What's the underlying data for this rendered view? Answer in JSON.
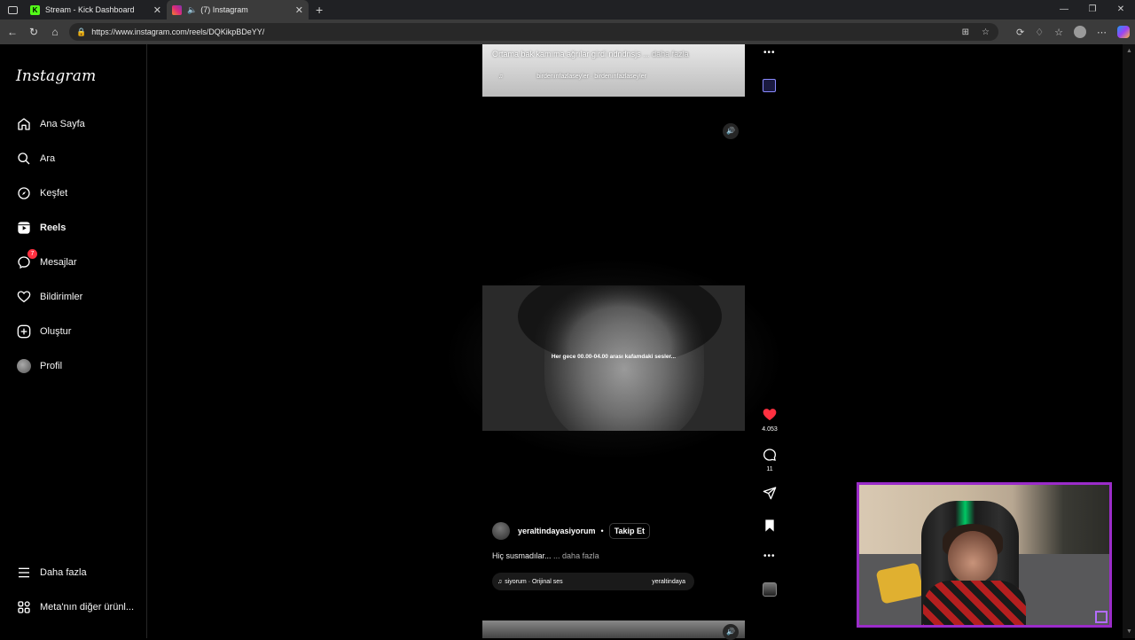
{
  "browser": {
    "tabs": [
      {
        "title": "Stream - Kick Dashboard",
        "active": false
      },
      {
        "title": "(7) Instagram",
        "active": true
      }
    ],
    "url": "https://www.instagram.com/reels/DQKikpBDeYY/"
  },
  "sidebar": {
    "logo": "Instagram",
    "items": [
      {
        "label": "Ana Sayfa",
        "icon": "home-icon"
      },
      {
        "label": "Ara",
        "icon": "search-icon"
      },
      {
        "label": "Keşfet",
        "icon": "compass-icon"
      },
      {
        "label": "Reels",
        "icon": "reels-icon",
        "active": true
      },
      {
        "label": "Mesajlar",
        "icon": "messenger-icon",
        "badge": "7"
      },
      {
        "label": "Bildirimler",
        "icon": "heart-icon"
      },
      {
        "label": "Oluştur",
        "icon": "plus-square-icon"
      },
      {
        "label": "Profil",
        "icon": "profile-avatar"
      }
    ],
    "bottom": [
      {
        "label": "Daha fazla",
        "icon": "menu-icon"
      },
      {
        "label": "Meta'nın diğer ürünl...",
        "icon": "grid-icon"
      }
    ]
  },
  "reel_prev": {
    "caption": "Ortama bak kamıma ağrılar girdi ndndnsjs",
    "more": "... daha fazla",
    "music_user": "birdenınfazlaseyler",
    "music_name": "birdenınfazlaseyler"
  },
  "reel_current": {
    "subtitle": "Her gece 00.00-04.00 arası kafamdaki sesler...",
    "likes": "4.053",
    "comments": "11",
    "author": "yeraltindayasiyorum",
    "follow_label": "Takip Et",
    "caption": "Hiç susmadılar...",
    "more": "... daha fazla",
    "audio_left": "siyorum · Orijinal ses",
    "audio_right": "yeraltindaya"
  },
  "colors": {
    "like": "#ff3040",
    "badge": "#ff3040",
    "cam_border": "#9b2cc9"
  }
}
